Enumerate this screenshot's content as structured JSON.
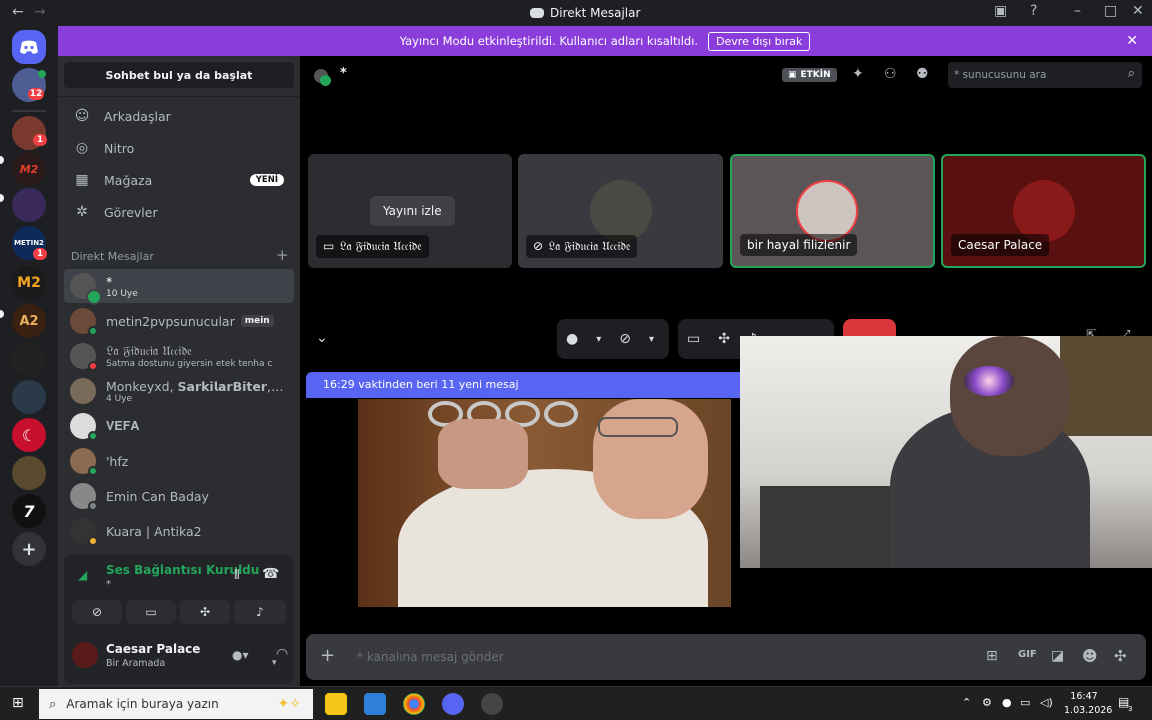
{
  "window": {
    "title": "Direkt Mesajlar"
  },
  "banner": {
    "text": "Yayıncı Modu etkinleştirildi. Kullanıcı adları kısaltıldı.",
    "button": "Devre dışı bırak"
  },
  "guilds": {
    "dm_badge": "12",
    "items": [
      {
        "label": "1",
        "badge": "1"
      },
      {
        "label": "M2"
      },
      {
        "label": ""
      },
      {
        "label": "METIN2",
        "badge": "1"
      },
      {
        "label": "M2"
      },
      {
        "label": "A2"
      },
      {
        "label": ""
      },
      {
        "label": ""
      },
      {
        "label": "☾"
      },
      {
        "label": ""
      },
      {
        "label": "7"
      }
    ]
  },
  "sidebar": {
    "search_button": "Sohbet bul ya da başlat",
    "nav": [
      {
        "label": "Arkadaşlar"
      },
      {
        "label": "Nitro"
      },
      {
        "label": "Mağaza",
        "badge": "YENİ"
      },
      {
        "label": "Görevler"
      }
    ],
    "dm_header": "Direkt Mesajlar",
    "dms": [
      {
        "name": "*",
        "sub": "10 Üye"
      },
      {
        "name": "metin2pvpsunucular",
        "tag": "mein"
      },
      {
        "name": "𝔏𝔞 𝔉𝔦𝔡𝔲𝔠𝔦𝔞 𝔘𝔠𝔠𝔦𝔡𝔢",
        "sub": "Satma dostunu giyersin etek tenha c"
      },
      {
        "name": "Monkeyxd, 𝗦𝗮𝗿𝗸𝗶𝗹𝗮𝗿𝗕𝗶𝘁𝗲𝗿, La ...",
        "sub": "4 Üye"
      },
      {
        "name": "𝐕𝐄𝐅𝐀"
      },
      {
        "name": "'hfz"
      },
      {
        "name": "Emin Can Baday"
      },
      {
        "name": "Kuara | Antika2"
      }
    ],
    "voice": {
      "status": "Ses Bağlantısı Kuruldu",
      "channel": "*"
    },
    "user": {
      "name": "Caesar Palace",
      "status": "Bir Aramada"
    }
  },
  "call": {
    "header_name": "*",
    "live_badge": "ETKİN",
    "search_placeholder": "* sunucusunu ara",
    "watch_button": "Yayını izle",
    "tiles": [
      {
        "label": "𝔏𝔞 𝔉𝔦𝔡𝔲𝔠𝔦𝔞 𝔘𝔠𝔠𝔦𝔡𝔢"
      },
      {
        "label": "𝔏𝔞 𝔉𝔦𝔡𝔲𝔠𝔦𝔞 𝔘𝔠𝔠𝔦𝔡𝔢"
      },
      {
        "label": "bir hayal filizlenir"
      },
      {
        "label": "Caesar Palace"
      }
    ],
    "new_messages": "16:29 vaktinden beri 11 yeni mesaj",
    "message_placeholder": "* kanalına mesaj gönder"
  },
  "taskbar": {
    "search_placeholder": "Aramak için buraya yazın",
    "time": "16:47",
    "date": "1.03.2026",
    "notif_count": "3"
  },
  "colors": {
    "accent": "#5865f2",
    "banner": "#8b3ddb",
    "online": "#23a55a",
    "danger": "#f23f43"
  }
}
